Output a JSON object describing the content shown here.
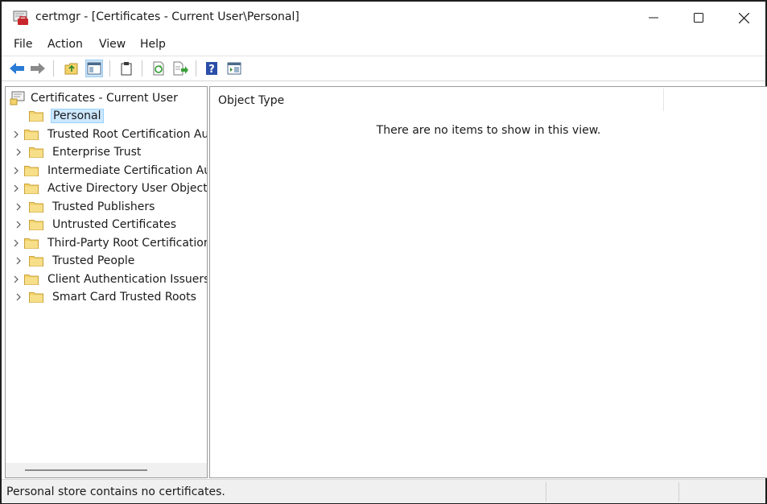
{
  "window": {
    "title": "certmgr - [Certificates - Current User\\Personal]",
    "icons": {
      "app": "certmgr-app-icon",
      "minimize": "minimize-icon",
      "maximize": "maximize-icon",
      "close": "close-icon"
    }
  },
  "menu": {
    "file": "File",
    "action": "Action",
    "view": "View",
    "help": "Help"
  },
  "toolbar": {
    "buttons": [
      "back-icon",
      "forward-icon",
      "up-folder-icon",
      "show-hide-console-tree-icon",
      "clipboard-icon",
      "refresh-icon",
      "export-list-icon",
      "help-icon",
      "properties-pane-icon"
    ]
  },
  "tree": {
    "root": "Certificates - Current User",
    "items": [
      {
        "label": "Personal",
        "selected": true
      },
      {
        "label": "Trusted Root Certification Au"
      },
      {
        "label": "Enterprise Trust"
      },
      {
        "label": "Intermediate Certification Au"
      },
      {
        "label": "Active Directory User Object"
      },
      {
        "label": "Trusted Publishers"
      },
      {
        "label": "Untrusted Certificates"
      },
      {
        "label": "Third-Party Root Certificatior"
      },
      {
        "label": "Trusted People"
      },
      {
        "label": "Client Authentication Issuers"
      },
      {
        "label": "Smart Card Trusted Roots"
      }
    ]
  },
  "list": {
    "column_header": "Object Type",
    "empty_message": "There are no items to show in this view."
  },
  "status": {
    "text": "Personal store contains no certificates."
  },
  "colors": {
    "selection_bg": "#cce8ff",
    "folder_yellow": "#f3d36a",
    "accent_blue": "#2a7bd5"
  }
}
